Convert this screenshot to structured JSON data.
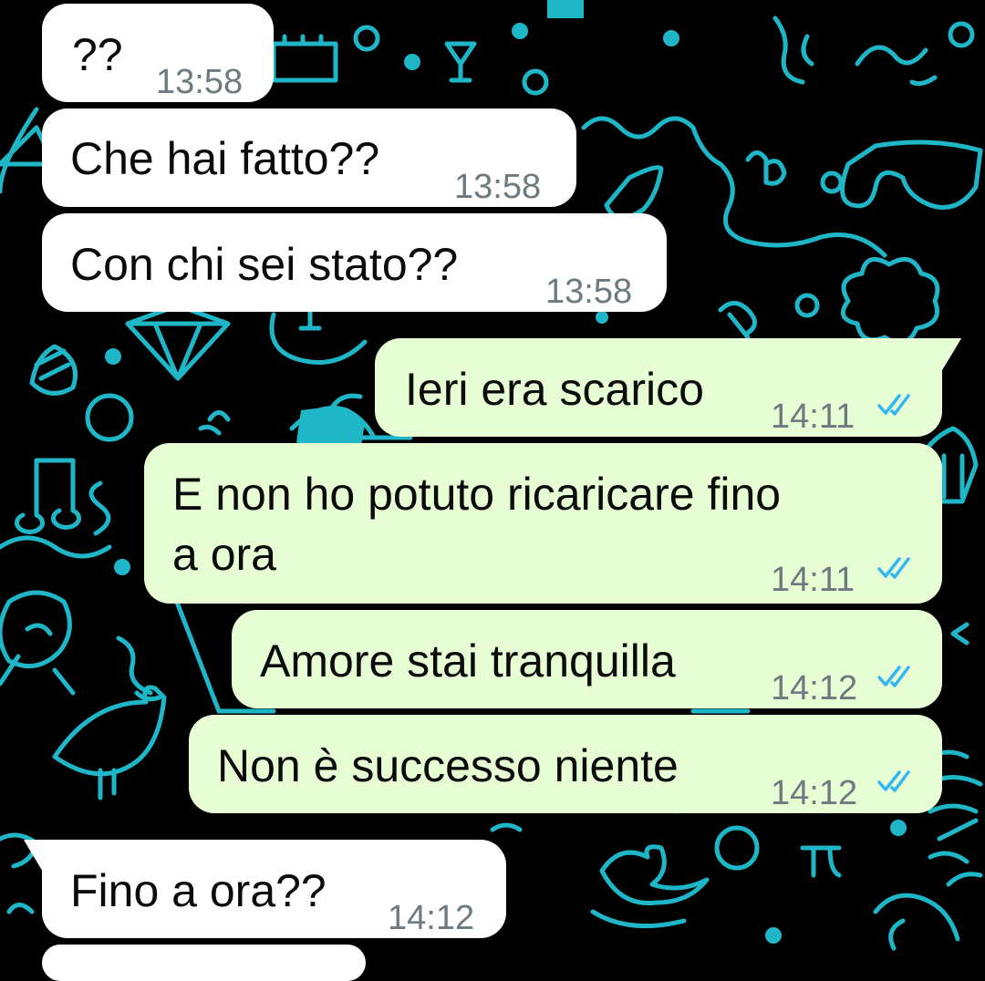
{
  "colors": {
    "incoming_bubble": "#ffffff",
    "outgoing_bubble": "#e7fdd3",
    "wallpaper": "#000000",
    "doodle": "#1fb6c8",
    "read_ticks": "#34b7f1",
    "time_text": "#6d7a80"
  },
  "messages": [
    {
      "direction": "incoming",
      "lines": [
        "??"
      ],
      "time": "13:58"
    },
    {
      "direction": "incoming",
      "lines": [
        "Che hai fatto??"
      ],
      "time": "13:58"
    },
    {
      "direction": "incoming",
      "lines": [
        "Con chi sei stato??"
      ],
      "time": "13:58"
    },
    {
      "direction": "outgoing",
      "lines": [
        "Ieri era scarico"
      ],
      "time": "14:11",
      "status": "read-double-check-icon"
    },
    {
      "direction": "outgoing",
      "lines": [
        "E non ho potuto ricaricare fino",
        "a ora"
      ],
      "time": "14:11",
      "status": "read-double-check-icon"
    },
    {
      "direction": "outgoing",
      "lines": [
        "Amore stai tranquilla"
      ],
      "time": "14:12",
      "status": "read-double-check-icon"
    },
    {
      "direction": "outgoing",
      "lines": [
        "Non è successo niente"
      ],
      "time": "14:12",
      "status": "read-double-check-icon"
    },
    {
      "direction": "incoming",
      "lines": [
        "Fino a ora??"
      ],
      "time": "14:12"
    }
  ]
}
